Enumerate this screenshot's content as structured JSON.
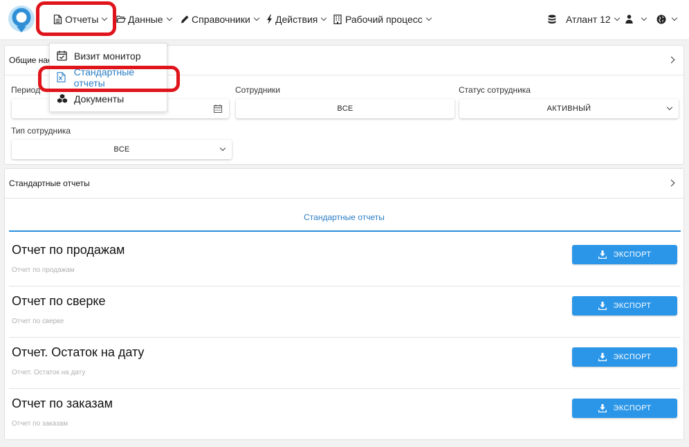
{
  "nav": {
    "items": [
      {
        "label": "Отчеты",
        "icon": "document-icon"
      },
      {
        "label": "Данные",
        "icon": "folder-open-icon"
      },
      {
        "label": "Справочники",
        "icon": "pencil-icon"
      },
      {
        "label": "Действия",
        "icon": "bolt-icon"
      },
      {
        "label": "Рабочий процесс",
        "icon": "building-icon"
      }
    ],
    "database_label": "Атлант 12"
  },
  "dropdown": {
    "items": [
      {
        "label": "Визит монитор",
        "icon": "calendar-check-icon"
      },
      {
        "label": "Стандартные отчеты",
        "icon": "excel-file-icon"
      },
      {
        "label": "Документы",
        "icon": "cubes-icon"
      }
    ]
  },
  "filters_panel": {
    "title": "Общие настройки",
    "period_label": "Период",
    "period_value": "",
    "employees_label": "Сотрудники",
    "employees_value": "ВСЕ",
    "status_label": "Статус сотрудника",
    "status_value": "АКТИВНЫЙ",
    "type_label": "Тип сотрудника",
    "type_value": "ВСЕ"
  },
  "reports_panel": {
    "title": "Стандартные отчеты",
    "tab_label": "Стандартные отчеты",
    "reports": [
      {
        "title": "Отчет по продажам",
        "subtitle": "Отчет по продажам",
        "button": "ЭКСПОРТ"
      },
      {
        "title": "Отчет по сверке",
        "subtitle": "Отчет по сверке",
        "button": "ЭКСПОРТ"
      },
      {
        "title": "Отчет. Остаток на дату",
        "subtitle": "Отчет. Остаток на дату",
        "button": "ЭКСПОРТ"
      },
      {
        "title": "Отчет по заказам",
        "subtitle": "Отчет по заказам",
        "button": "ЭКСПОРТ"
      }
    ]
  },
  "colors": {
    "accent": "#2a7dc3",
    "button": "#2b96e8",
    "highlight": "#e0141b"
  }
}
